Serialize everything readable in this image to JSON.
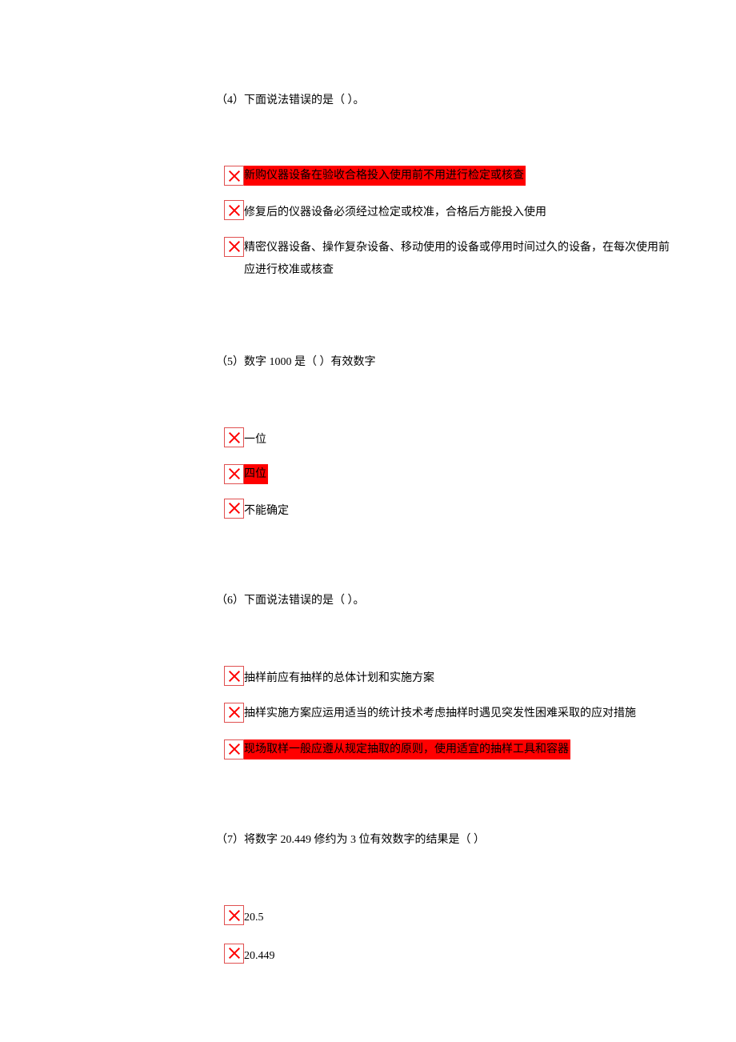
{
  "questions": [
    {
      "number": "（4）",
      "text": "下面说法错误的是（ ）。",
      "options": [
        {
          "text": "新购仪器设备在验收合格投入使用前不用进行检定或核查",
          "highlighted": true
        },
        {
          "text": "修复后的仪器设备必须经过检定或校准，合格后方能投入使用",
          "highlighted": false
        },
        {
          "text": "精密仪器设备、操作复杂设备、移动使用的设备或停用时间过久的设备，在每次使用前应进行校准或核查",
          "highlighted": false
        }
      ]
    },
    {
      "number": "（5）",
      "text": "数字 1000 是（ ）有效数字",
      "options": [
        {
          "text": "一位",
          "highlighted": false
        },
        {
          "text": "四位",
          "highlighted": true
        },
        {
          "text": "不能确定",
          "highlighted": false
        }
      ]
    },
    {
      "number": "（6）",
      "text": "下面说法错误的是（ ）。",
      "options": [
        {
          "text": "抽样前应有抽样的总体计划和实施方案",
          "highlighted": false
        },
        {
          "text": "抽样实施方案应运用适当的统计技术考虑抽样时遇见突发性困难采取的应对措施",
          "highlighted": false
        },
        {
          "text": "现场取样一般应遵从规定抽取的原则，使用适宜的抽样工具和容器",
          "highlighted": true
        }
      ]
    },
    {
      "number": "（7）",
      "text": "将数字 20.449 修约为 3 位有效数字的结果是（ ）",
      "options": [
        {
          "text": "20.5",
          "highlighted": false
        },
        {
          "text": "20.449",
          "highlighted": false
        }
      ]
    }
  ]
}
